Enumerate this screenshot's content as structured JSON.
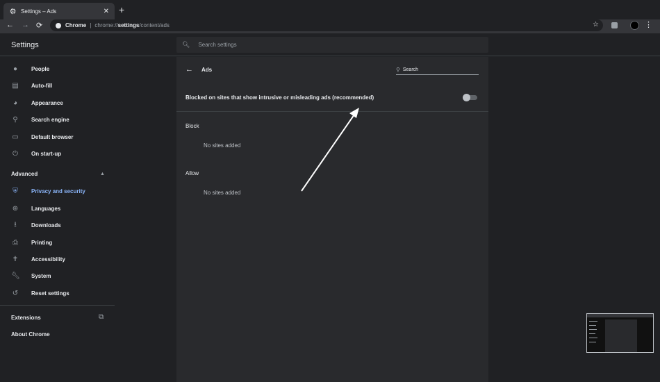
{
  "tab": {
    "title": "Settings – Ads",
    "favicon": "gear-icon",
    "close": "✕"
  },
  "toolbar": {
    "chrome_label": "Chrome",
    "url_prefix": "chrome://",
    "url_bold": "settings",
    "url_suffix": "/content/ads"
  },
  "header": {
    "title": "Settings",
    "search_placeholder": "Search settings"
  },
  "sidebar": {
    "items": [
      {
        "label": "People",
        "icon": "person-icon"
      },
      {
        "label": "Auto-fill",
        "icon": "clipboard-icon"
      },
      {
        "label": "Appearance",
        "icon": "palette-icon"
      },
      {
        "label": "Search engine",
        "icon": "search-icon"
      },
      {
        "label": "Default browser",
        "icon": "browser-icon"
      },
      {
        "label": "On start-up",
        "icon": "power-icon"
      }
    ],
    "advanced_label": "Advanced",
    "advanced_items": [
      {
        "label": "Privacy and security",
        "icon": "shield-icon",
        "active": true
      },
      {
        "label": "Languages",
        "icon": "globe-icon"
      },
      {
        "label": "Downloads",
        "icon": "download-icon"
      },
      {
        "label": "Printing",
        "icon": "printer-icon"
      },
      {
        "label": "Accessibility",
        "icon": "accessibility-icon"
      },
      {
        "label": "System",
        "icon": "wrench-icon"
      },
      {
        "label": "Reset settings",
        "icon": "history-icon"
      }
    ],
    "extensions_label": "Extensions",
    "about_label": "About Chrome"
  },
  "page": {
    "title": "Ads",
    "search_placeholder": "Search",
    "blocked_label": "Blocked on sites that show intrusive or misleading ads (recommended)",
    "blocked_toggle_on": false,
    "block_section": "Block",
    "block_empty": "No sites added",
    "allow_section": "Allow",
    "allow_empty": "No sites added"
  },
  "colors": {
    "accent": "#8ab4f8",
    "background": "#202124",
    "card": "#292a2d"
  }
}
